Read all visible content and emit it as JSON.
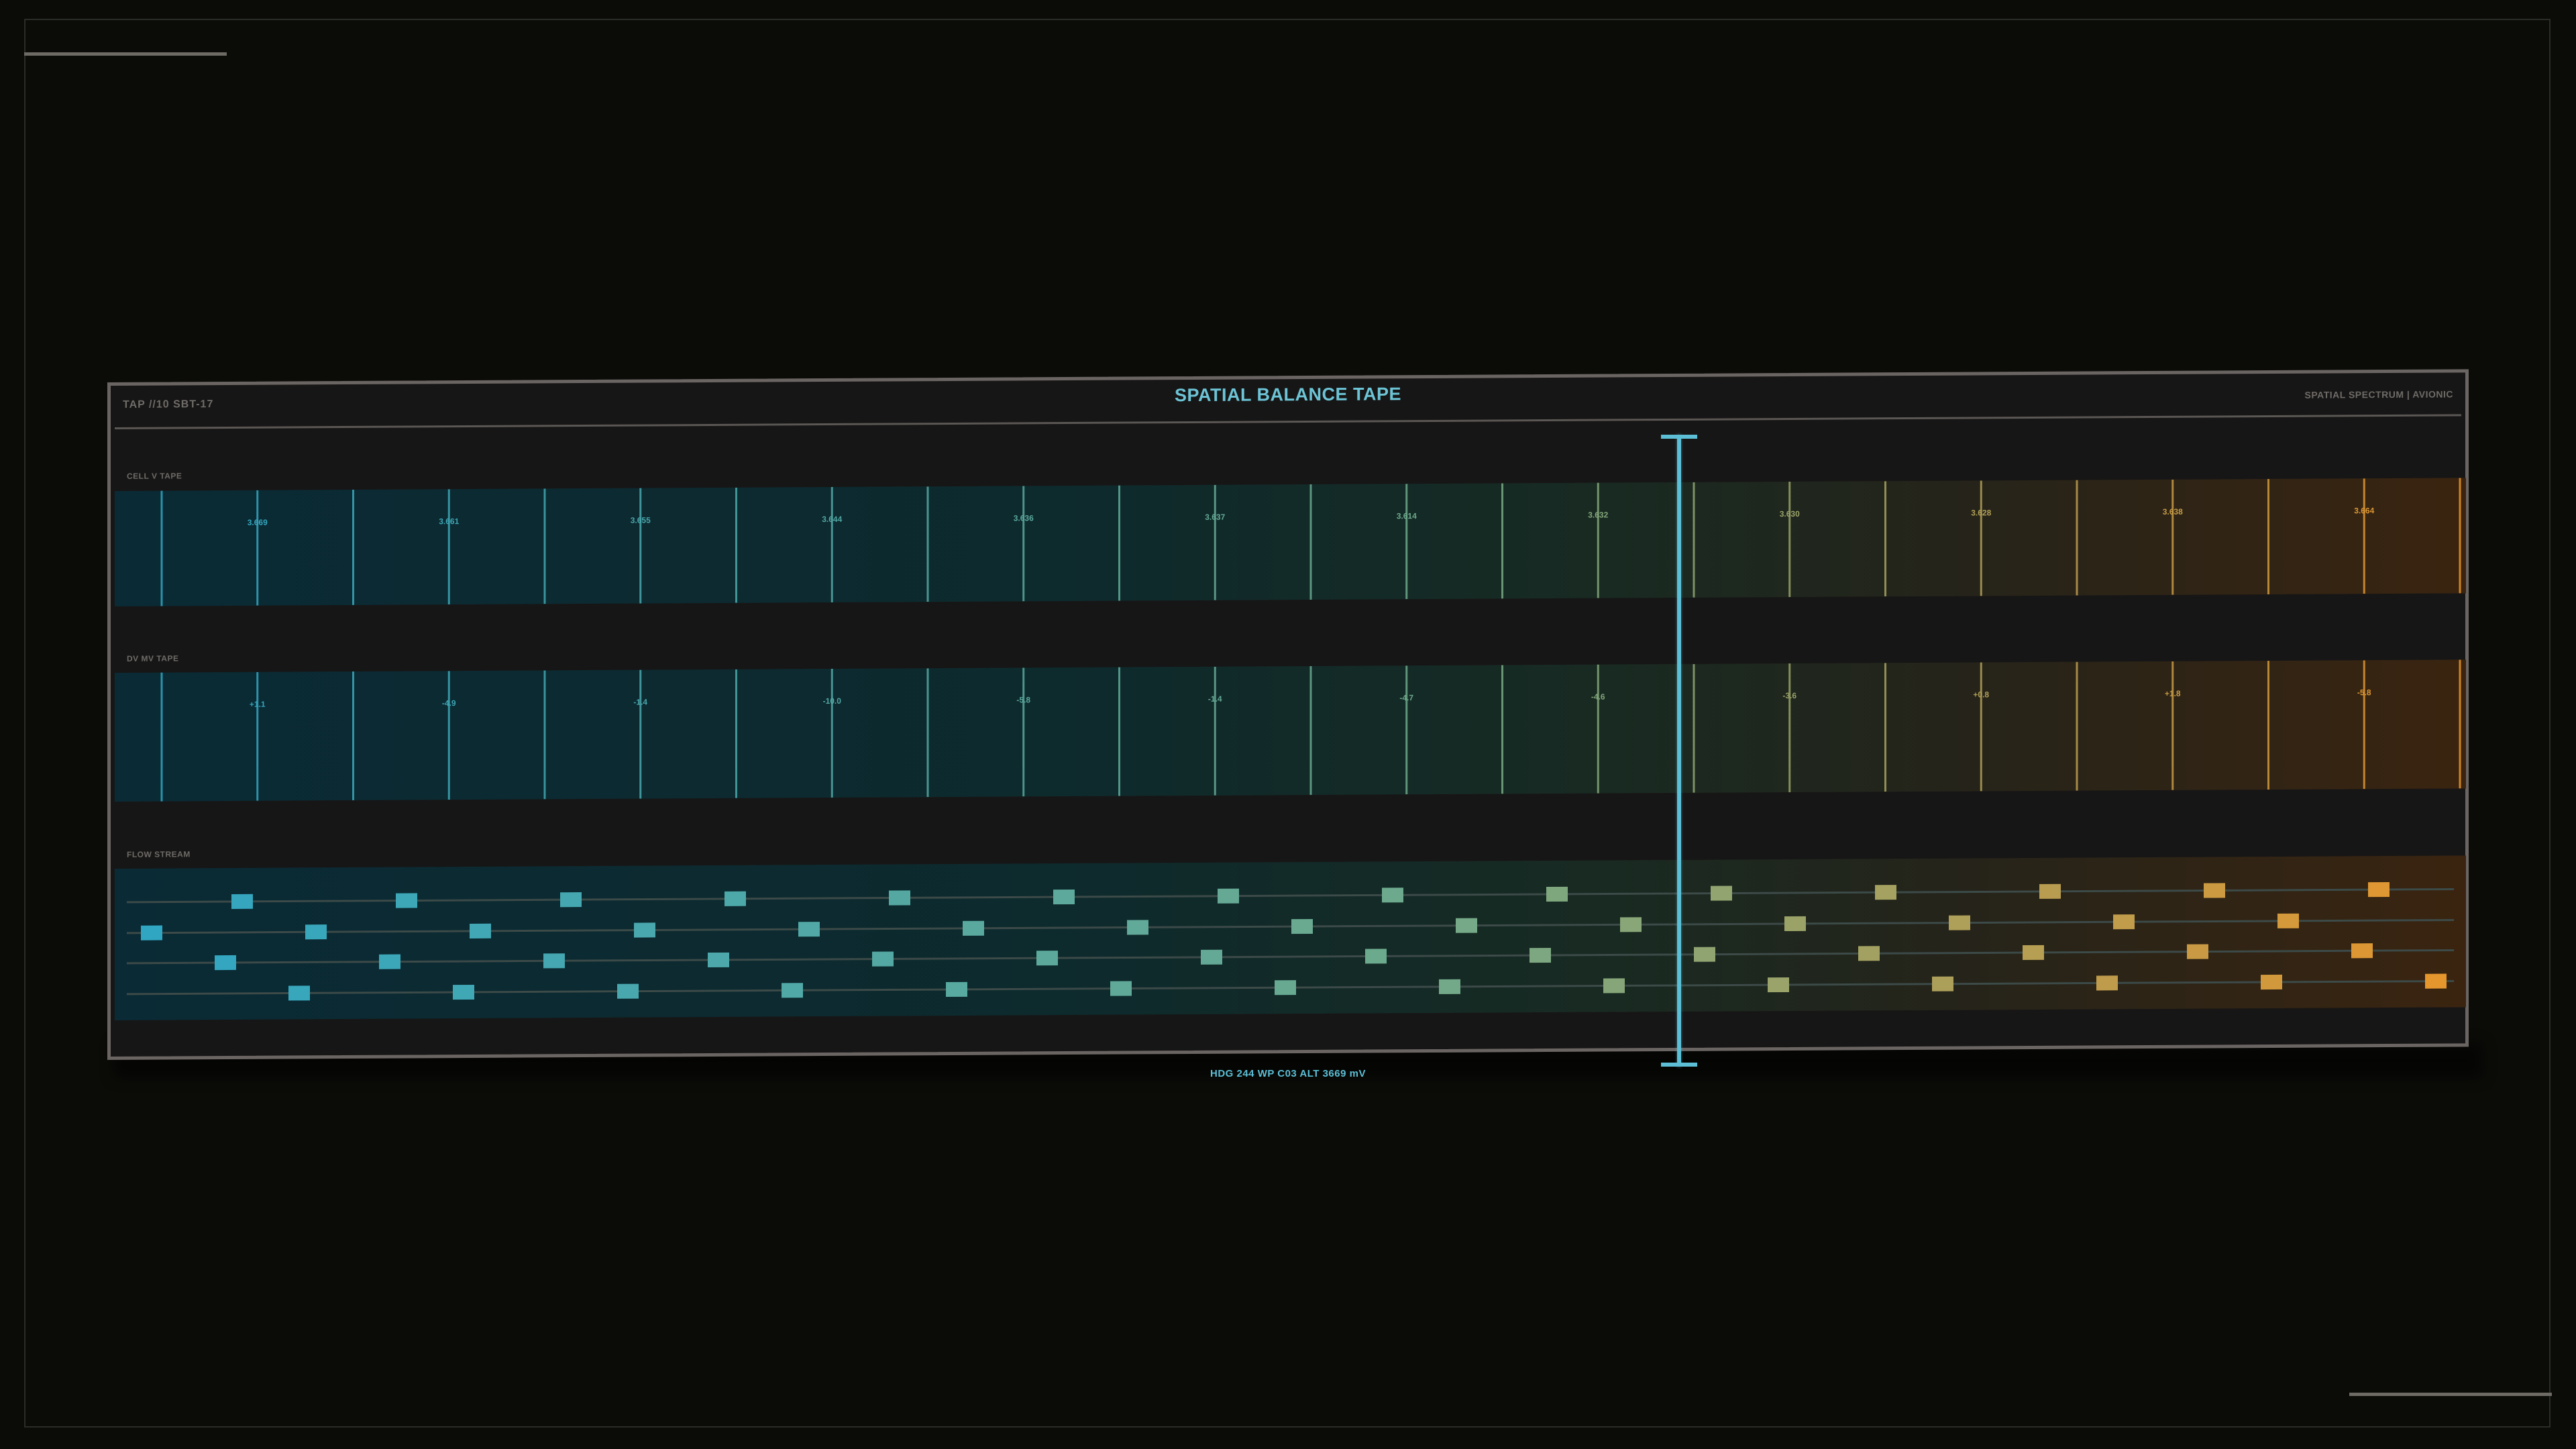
{
  "header": {
    "left_tag": "TAP //10 SBT-17",
    "title": "SPATIAL BALANCE TAPE",
    "right_tag": "SPATIAL SPECTRUM | AVIONIC"
  },
  "bands": {
    "cell_v": {
      "label": "CELL V TAPE",
      "values": [
        "3.669",
        "3.661",
        "3.655",
        "3.644",
        "3.636",
        "3.637",
        "3.614",
        "3.632",
        "3.630",
        "3.628",
        "3.638",
        "3.664"
      ]
    },
    "dv": {
      "label": "dV mV TAPE",
      "values": [
        "+1.1",
        "-4.9",
        "-1.4",
        "-10.0",
        "-5.8",
        "-1.4",
        "-4.7",
        "-4.6",
        "-3.6",
        "+0.8",
        "+1.8",
        "-5.8"
      ]
    },
    "flow": {
      "label": "FLOW STREAM",
      "lanes": 4
    }
  },
  "cursor": {
    "readout": "HDG 244   WP C03   ALT 3669 mV"
  },
  "colors": {
    "accent": "#5cbfd6",
    "cool": "#2fa6c4",
    "warm": "#e8952a",
    "panel_border": "#6a6562"
  }
}
